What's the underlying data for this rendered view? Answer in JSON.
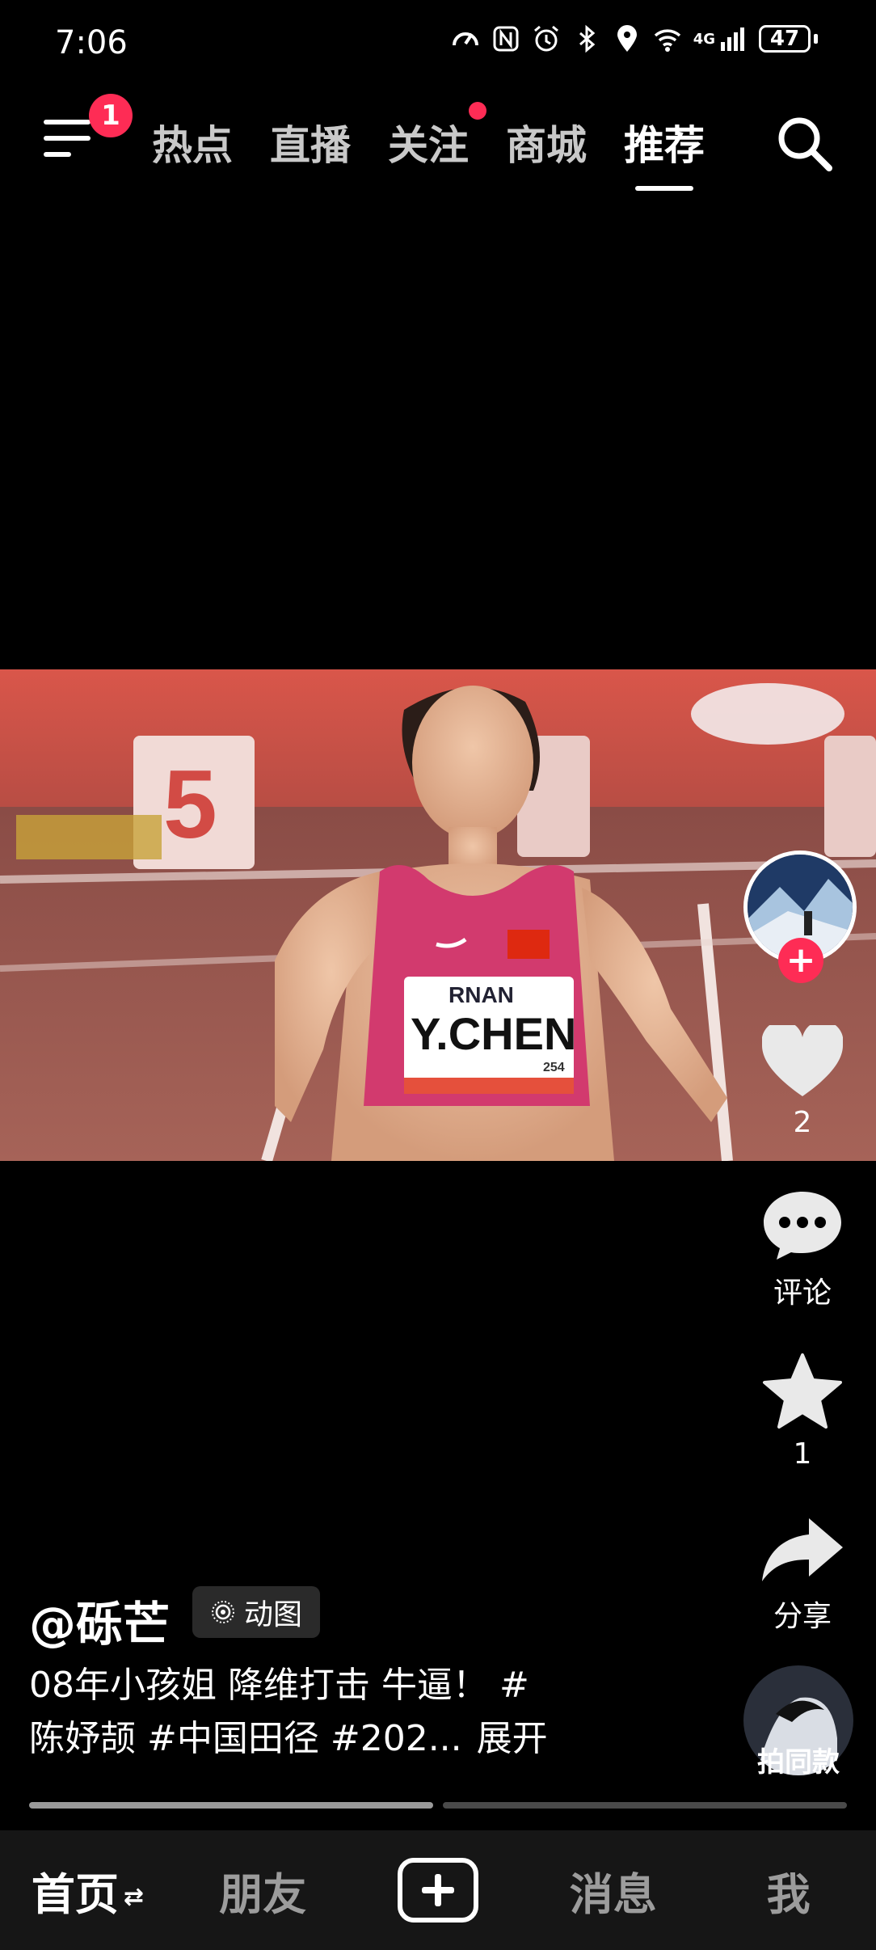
{
  "status_bar": {
    "time": "7:06",
    "network": "4G",
    "battery": "47",
    "icons": [
      "speed-icon",
      "nfc-icon",
      "alarm-icon",
      "bluetooth-icon",
      "location-icon",
      "wifi-icon",
      "signal-icon",
      "battery-icon"
    ]
  },
  "top_nav": {
    "menu_badge": "1",
    "tabs": [
      {
        "label": "热点",
        "active": false,
        "dot": false
      },
      {
        "label": "直播",
        "active": false,
        "dot": false
      },
      {
        "label": "关注",
        "active": false,
        "dot": true
      },
      {
        "label": "商城",
        "active": false,
        "dot": false
      },
      {
        "label": "推荐",
        "active": true,
        "dot": false
      }
    ],
    "accent_color": "#fe2c55"
  },
  "video": {
    "bib_brand": "RNAN",
    "bib_name": "Y.CHEN",
    "bib_number": "254",
    "lane_number": "5"
  },
  "side_rail": {
    "follow_plus": "+",
    "like_count": "2",
    "comment_label": "评论",
    "favorite_count": "1",
    "share_label": "分享",
    "same_style_label": "拍同款"
  },
  "post": {
    "author": "@砾芒",
    "chip_label": "动图",
    "caption_line1": "08年小孩姐  降维打击 牛逼！ #",
    "caption_line2": "陈妤颉 #中国田径 #202...",
    "expand_label": "展开"
  },
  "progress": {
    "segments": 2,
    "current": 1
  },
  "bottom_nav": {
    "items": [
      {
        "label": "首页",
        "active": true
      },
      {
        "label": "朋友",
        "active": false
      },
      {
        "label": "+",
        "active": false
      },
      {
        "label": "消息",
        "active": false
      },
      {
        "label": "我",
        "active": false
      }
    ],
    "swap_glyph": "⇄"
  }
}
